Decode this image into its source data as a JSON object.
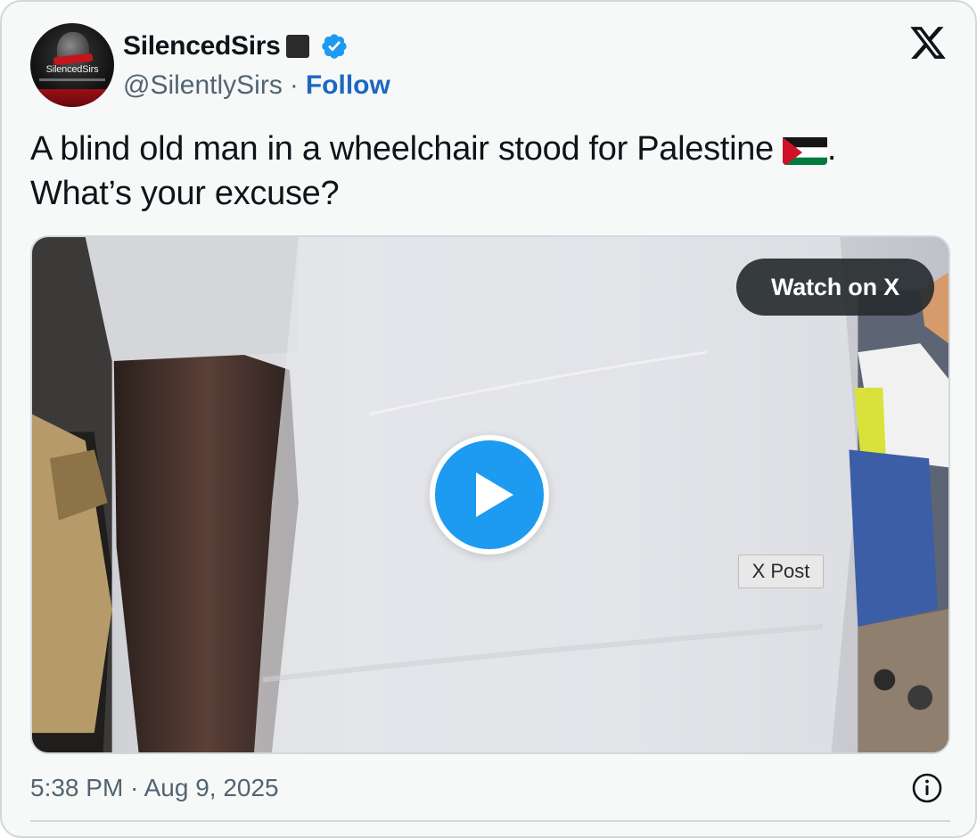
{
  "author": {
    "display_name": "SilencedSirs",
    "handle": "@SilentlySirs",
    "separator": "·",
    "follow_label": "Follow",
    "avatar_wordmark": "SilencedSirs",
    "verified_icon": "verified-badge-icon"
  },
  "tweet": {
    "line1": "A blind old man in a wheelchair stood for Palestine",
    "line1_end": ".",
    "line2": "What’s your excuse?",
    "emoji": "palestine-flag-emoji"
  },
  "media": {
    "watch_label": "Watch on X",
    "post_tag": "X Post",
    "play_icon": "play-icon"
  },
  "footer": {
    "timestamp": "5:38 PM · Aug 9, 2025",
    "info_icon": "info-icon"
  },
  "colors": {
    "verified": "#1d9bf0",
    "follow": "#1d68c2",
    "play": "#1d9bf0",
    "muted_text": "#536471",
    "flag_red": "#ce1126",
    "flag_green": "#007a3d"
  }
}
